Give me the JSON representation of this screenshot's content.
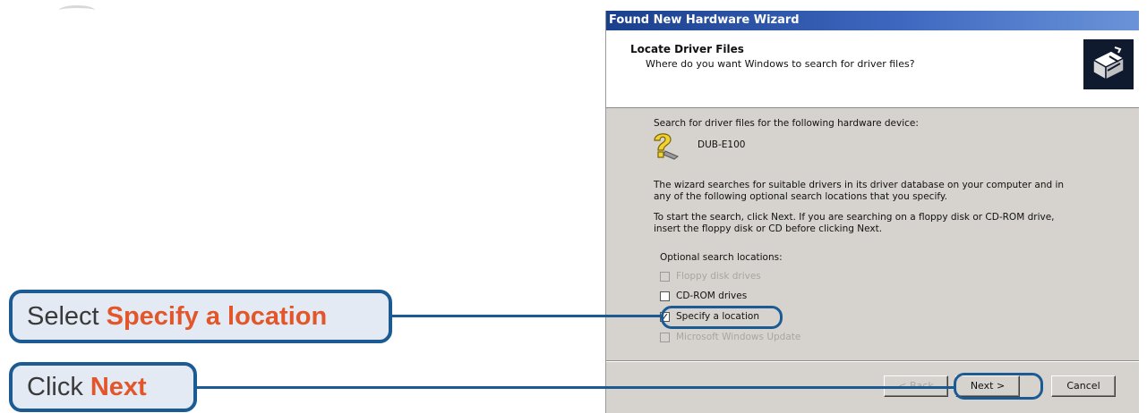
{
  "wizard": {
    "title": "Found New Hardware Wizard",
    "header_title": "Locate Driver Files",
    "header_subtitle": "Where do you want Windows to search for driver files?",
    "search_label": "Search for driver files for the following hardware device:",
    "device_name": "DUB-E100",
    "para1_line1": "The wizard searches for suitable drivers in its driver database on your computer and in",
    "para1_line2": "any of the following optional search locations that you specify.",
    "para2_line1": "To start the search, click Next. If you are searching on a floppy disk or CD-ROM drive,",
    "para2_line2": "insert the floppy disk or CD before clicking Next.",
    "optional_label": "Optional search locations:",
    "options": [
      {
        "label": "Floppy disk drives",
        "checked": false,
        "enabled": false
      },
      {
        "label": "CD-ROM drives",
        "checked": false,
        "enabled": true
      },
      {
        "label": "Specify a location",
        "checked": true,
        "enabled": true
      },
      {
        "label": "Microsoft Windows Update",
        "checked": false,
        "enabled": false
      }
    ],
    "buttons": {
      "back": "< Back",
      "next": "Next >",
      "cancel": "Cancel"
    }
  },
  "callouts": {
    "select": {
      "prefix": "Select",
      "highlight": "Specify a location"
    },
    "click": {
      "prefix": "Click",
      "highlight": "Next"
    }
  },
  "colors": {
    "callout_border": "#1c5a94",
    "highlight": "#e2562a",
    "titlebar": "#2b56a8"
  }
}
